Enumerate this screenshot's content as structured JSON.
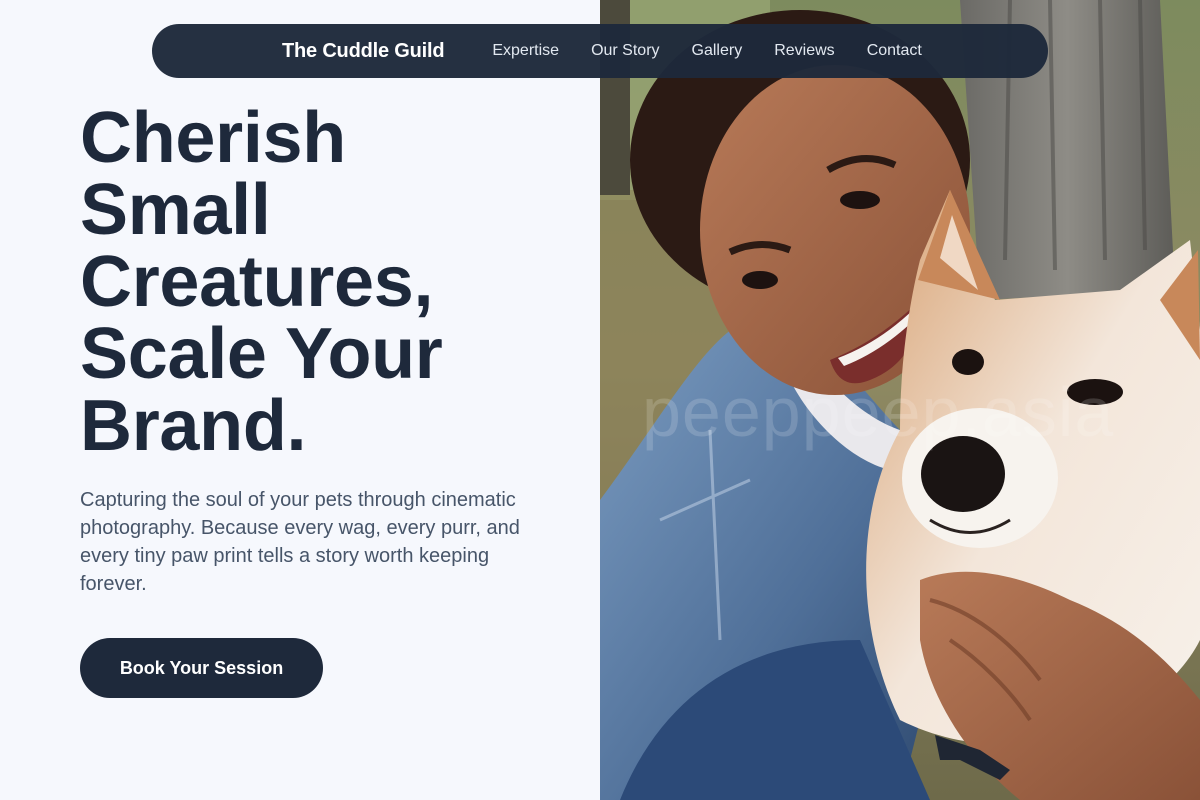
{
  "nav": {
    "brand": "The Cuddle Guild",
    "links": [
      "Expertise",
      "Our Story",
      "Gallery",
      "Reviews",
      "Contact"
    ]
  },
  "hero": {
    "headline_lines": [
      "Cherish",
      "Small",
      "Creatures,",
      "Scale Your",
      "Brand."
    ],
    "subtitle": "Capturing the soul of your pets through cinematic photography. Because every wag, every purr, and every tiny paw print tells a story worth keeping forever.",
    "cta_label": "Book Your Session",
    "photo_watermark": "peeppeep.asia"
  },
  "colors": {
    "page_bg": "#f6f8fd",
    "navy": "#1e293b",
    "body_text": "#475569",
    "nav_text": "#e2e8f0"
  }
}
